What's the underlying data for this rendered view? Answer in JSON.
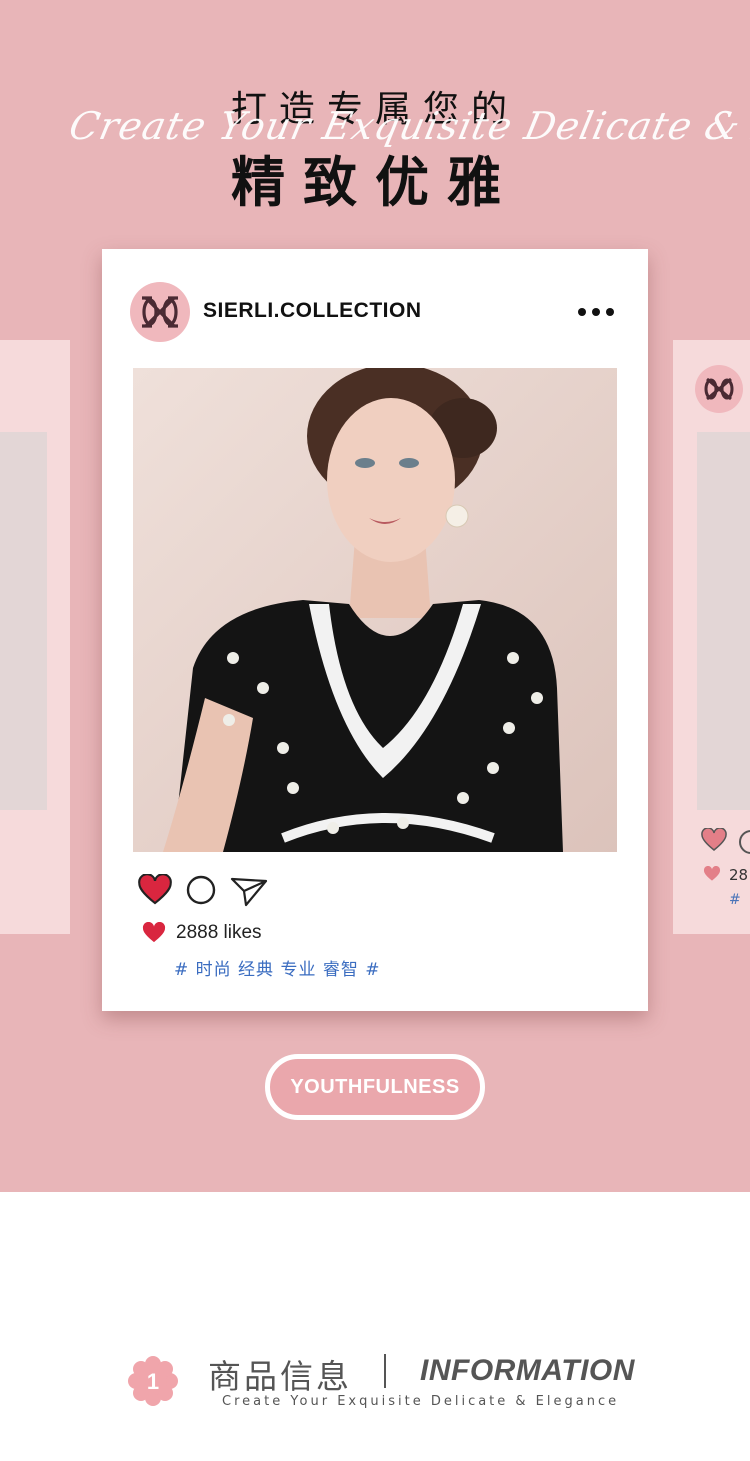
{
  "headline": {
    "line1": "打造专属您的",
    "line2": "精致优雅",
    "script": "Create Your Exquisite Delicate & Elegance"
  },
  "post": {
    "username": "SIERLI.COLLECTION",
    "likes": "2888 likes",
    "tags": "# 时尚 经典 专业 睿智 #"
  },
  "side_right": {
    "likes_fragment": "28",
    "tag_fragment": "#"
  },
  "pill_label": "YOUTHFULNESS",
  "footer": {
    "badge_number": "1",
    "title_cn": "商品信息",
    "title_en": "INFORMATION",
    "subtitle": "Create Your Exquisite Delicate & Elegance"
  },
  "colors": {
    "background_pink": "#e8b5b8",
    "heart_red": "#d9263f",
    "tag_blue": "#3a6cc0"
  },
  "icons": [
    "heart-icon",
    "comment-icon",
    "send-icon",
    "more-icon",
    "logo-icon",
    "flower-badge-icon"
  ]
}
